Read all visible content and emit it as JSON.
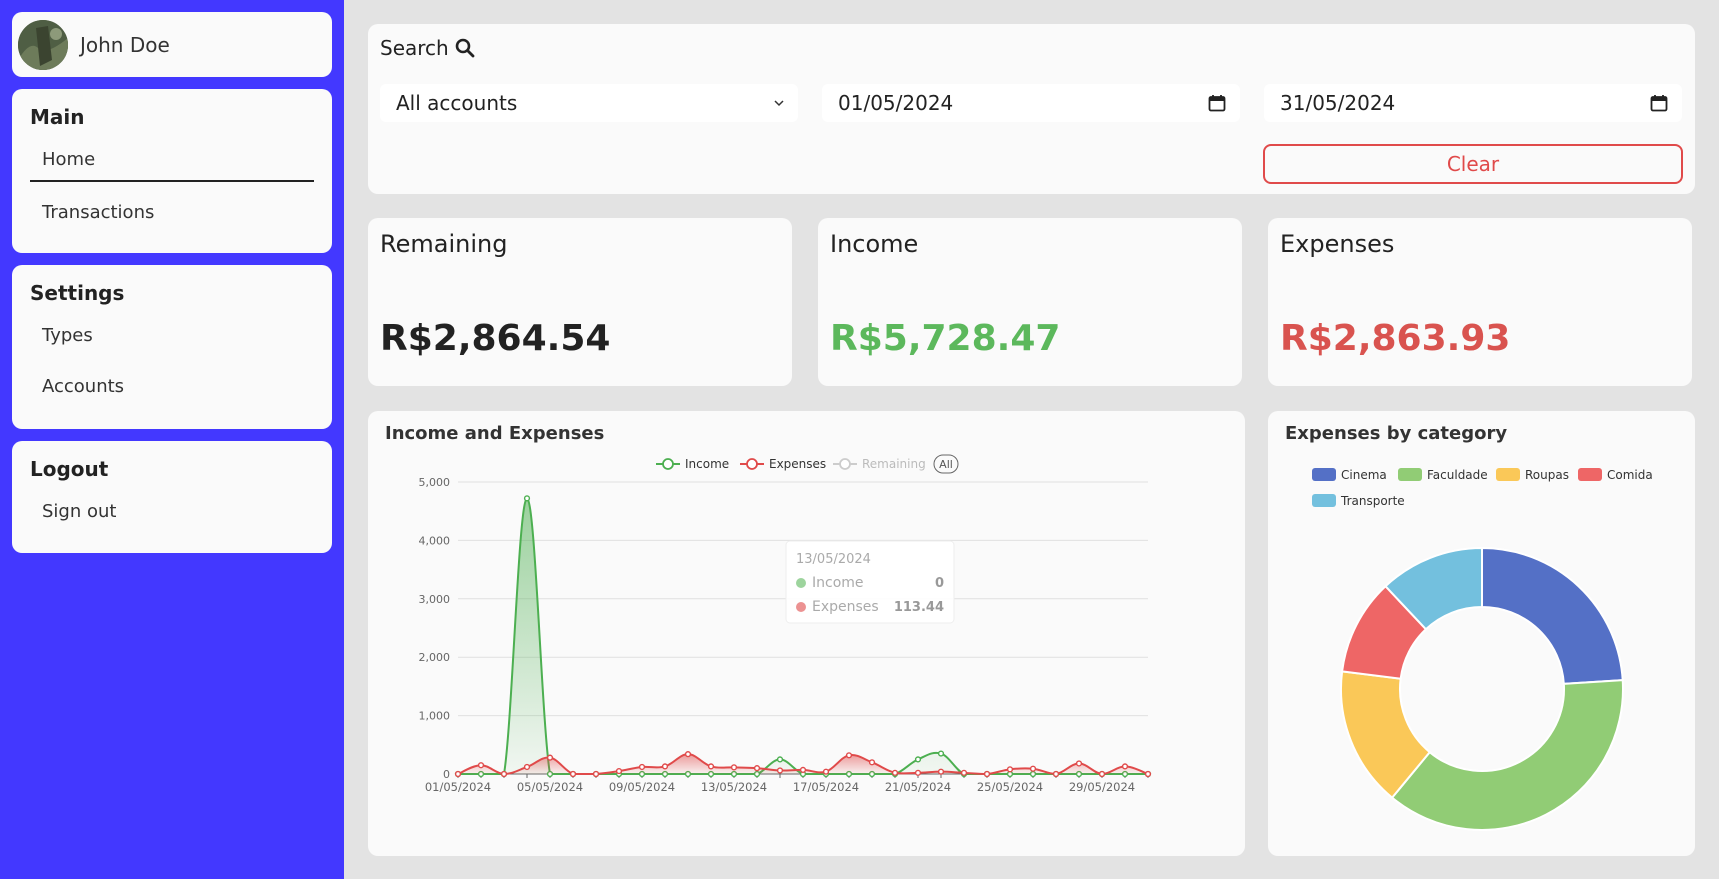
{
  "user": {
    "name": "John Doe"
  },
  "nav": {
    "main": {
      "title": "Main",
      "items": [
        {
          "label": "Home"
        },
        {
          "label": "Transactions"
        }
      ]
    },
    "settings": {
      "title": "Settings",
      "items": [
        {
          "label": "Types"
        },
        {
          "label": "Accounts"
        }
      ]
    },
    "logout": {
      "title": "Logout",
      "items": [
        {
          "label": "Sign out"
        }
      ]
    }
  },
  "search": {
    "title": "Search",
    "account_select": "All accounts",
    "date_from": "01/05/2024",
    "date_to": "31/05/2024",
    "clear_label": "Clear"
  },
  "stats": {
    "remaining": {
      "label": "Remaining",
      "value": "R$2,864.54",
      "color": "#222222"
    },
    "income": {
      "label": "Income",
      "value": "R$5,728.47",
      "color": "#5cb85c"
    },
    "expenses": {
      "label": "Expenses",
      "value": "R$2,863.93",
      "color": "#d9534f"
    }
  },
  "tooltip": {
    "date": "13/05/2024",
    "rows": [
      {
        "name": "Income",
        "value": "0"
      },
      {
        "name": "Expenses",
        "value": "113.44"
      }
    ]
  },
  "chart_data": [
    {
      "type": "line",
      "title": "Income and Expenses",
      "legend": [
        "Income",
        "Expenses",
        "Remaining",
        "All"
      ],
      "legend_placement": "top",
      "x": [
        "01/05/2024",
        "02/05/2024",
        "03/05/2024",
        "04/05/2024",
        "05/05/2024",
        "06/05/2024",
        "07/05/2024",
        "08/05/2024",
        "09/05/2024",
        "10/05/2024",
        "11/05/2024",
        "12/05/2024",
        "13/05/2024",
        "14/05/2024",
        "15/05/2024",
        "16/05/2024",
        "17/05/2024",
        "18/05/2024",
        "19/05/2024",
        "20/05/2024",
        "21/05/2024",
        "22/05/2024",
        "23/05/2024",
        "24/05/2024",
        "25/05/2024",
        "26/05/2024",
        "27/05/2024",
        "28/05/2024",
        "29/05/2024",
        "30/05/2024",
        "31/05/2024"
      ],
      "x_tick_labels": [
        "01/05/2024",
        "05/05/2024",
        "09/05/2024",
        "13/05/2024",
        "17/05/2024",
        "21/05/2024",
        "25/05/2024",
        "29/05/2024"
      ],
      "series": [
        {
          "name": "Income",
          "color": "#4caf50",
          "values": [
            0,
            0,
            0,
            4720,
            0,
            0,
            0,
            0,
            0,
            0,
            0,
            0,
            0,
            0,
            250,
            0,
            0,
            0,
            0,
            0,
            250,
            350,
            0,
            0,
            0,
            0,
            0,
            0,
            0,
            0,
            0
          ]
        },
        {
          "name": "Expenses",
          "color": "#e04a4a",
          "values": [
            0,
            150,
            0,
            120,
            280,
            0,
            0,
            50,
            120,
            130,
            340,
            130,
            113.44,
            100,
            60,
            70,
            40,
            320,
            200,
            20,
            20,
            40,
            20,
            0,
            80,
            90,
            0,
            180,
            0,
            130,
            0
          ]
        }
      ],
      "yticks": [
        0,
        1000,
        2000,
        3000,
        4000,
        5000
      ],
      "ylim": [
        0,
        5000
      ],
      "grid": true
    },
    {
      "type": "pie",
      "title": "Expenses by category",
      "legend_placement": "top",
      "categories": [
        "Cinema",
        "Faculdade",
        "Roupas",
        "Comida",
        "Transporte"
      ],
      "colors": [
        "#5470c6",
        "#91cc75",
        "#fac858",
        "#ee6666",
        "#73c0de"
      ],
      "values": [
        24,
        37,
        16,
        11,
        12
      ]
    }
  ]
}
